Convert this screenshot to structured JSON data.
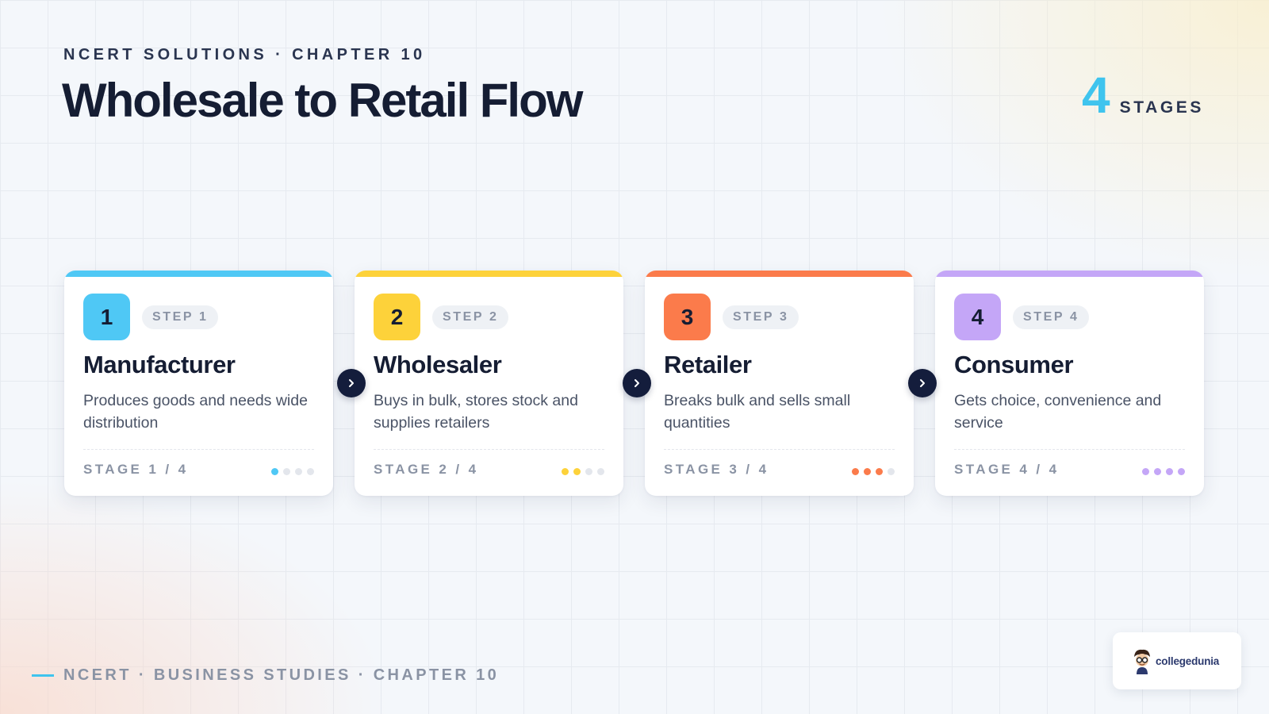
{
  "header": {
    "eyebrow": "NCERT SOLUTIONS · CHAPTER 10",
    "title": "Wholesale to Retail Flow",
    "stage_count": "4",
    "stage_count_label": "STAGES"
  },
  "steps": [
    {
      "number": "1",
      "step_label": "STEP 1",
      "name": "Manufacturer",
      "description": "Produces goods and needs wide distribution",
      "stage_label": "STAGE 1 / 4",
      "color": "#4fc8f5",
      "progress": 1
    },
    {
      "number": "2",
      "step_label": "STEP 2",
      "name": "Wholesaler",
      "description": "Buys in bulk, stores stock and supplies retailers",
      "stage_label": "STAGE 2 / 4",
      "color": "#fdd23a",
      "progress": 2
    },
    {
      "number": "3",
      "step_label": "STEP 3",
      "name": "Retailer",
      "description": "Breaks bulk and sells small quantities",
      "stage_label": "STAGE 3 / 4",
      "color": "#fb7b4b",
      "progress": 3
    },
    {
      "number": "4",
      "step_label": "STEP 4",
      "name": "Consumer",
      "description": "Gets choice, convenience and service",
      "stage_label": "STAGE 4 / 4",
      "color": "#c4a6f7",
      "progress": 4
    }
  ],
  "total_stages": 4,
  "footer": {
    "text": "NCERT · BUSINESS STUDIES · CHAPTER 10"
  },
  "logo": {
    "text": "collegedunia"
  },
  "icons": {
    "arrow": "chevron-right-icon",
    "logo": "mascot-icon"
  }
}
